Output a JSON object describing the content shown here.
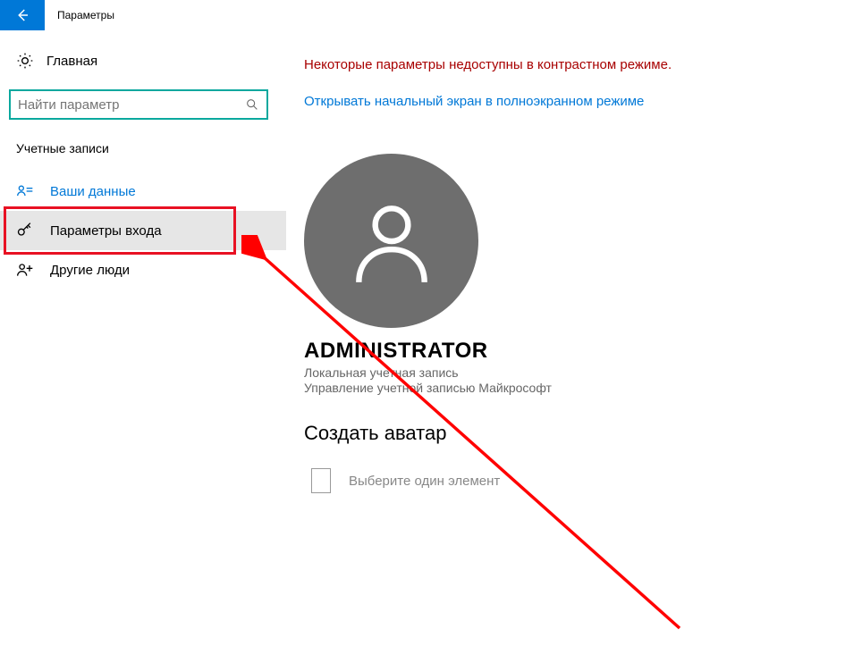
{
  "titlebar": {
    "title": "Параметры"
  },
  "sidebar": {
    "home_label": "Главная",
    "search_placeholder": "Найти параметр",
    "section_label": "Учетные записи",
    "items": [
      {
        "label": "Ваши данные"
      },
      {
        "label": "Параметры входа"
      },
      {
        "label": "Другие люди"
      }
    ]
  },
  "content": {
    "notice": "Некоторые параметры недоступны в контрастном режиме.",
    "fullscreen_link": "Открывать начальный экран в полноэкранном режиме",
    "user_name": "ADMINISTRATOR",
    "user_sub1": "Локальная учетная запись",
    "user_sub2": "Управление учетной записью Майкрософт",
    "create_avatar_heading": "Создать аватар",
    "select_one_label": "Выберите один элемент"
  }
}
